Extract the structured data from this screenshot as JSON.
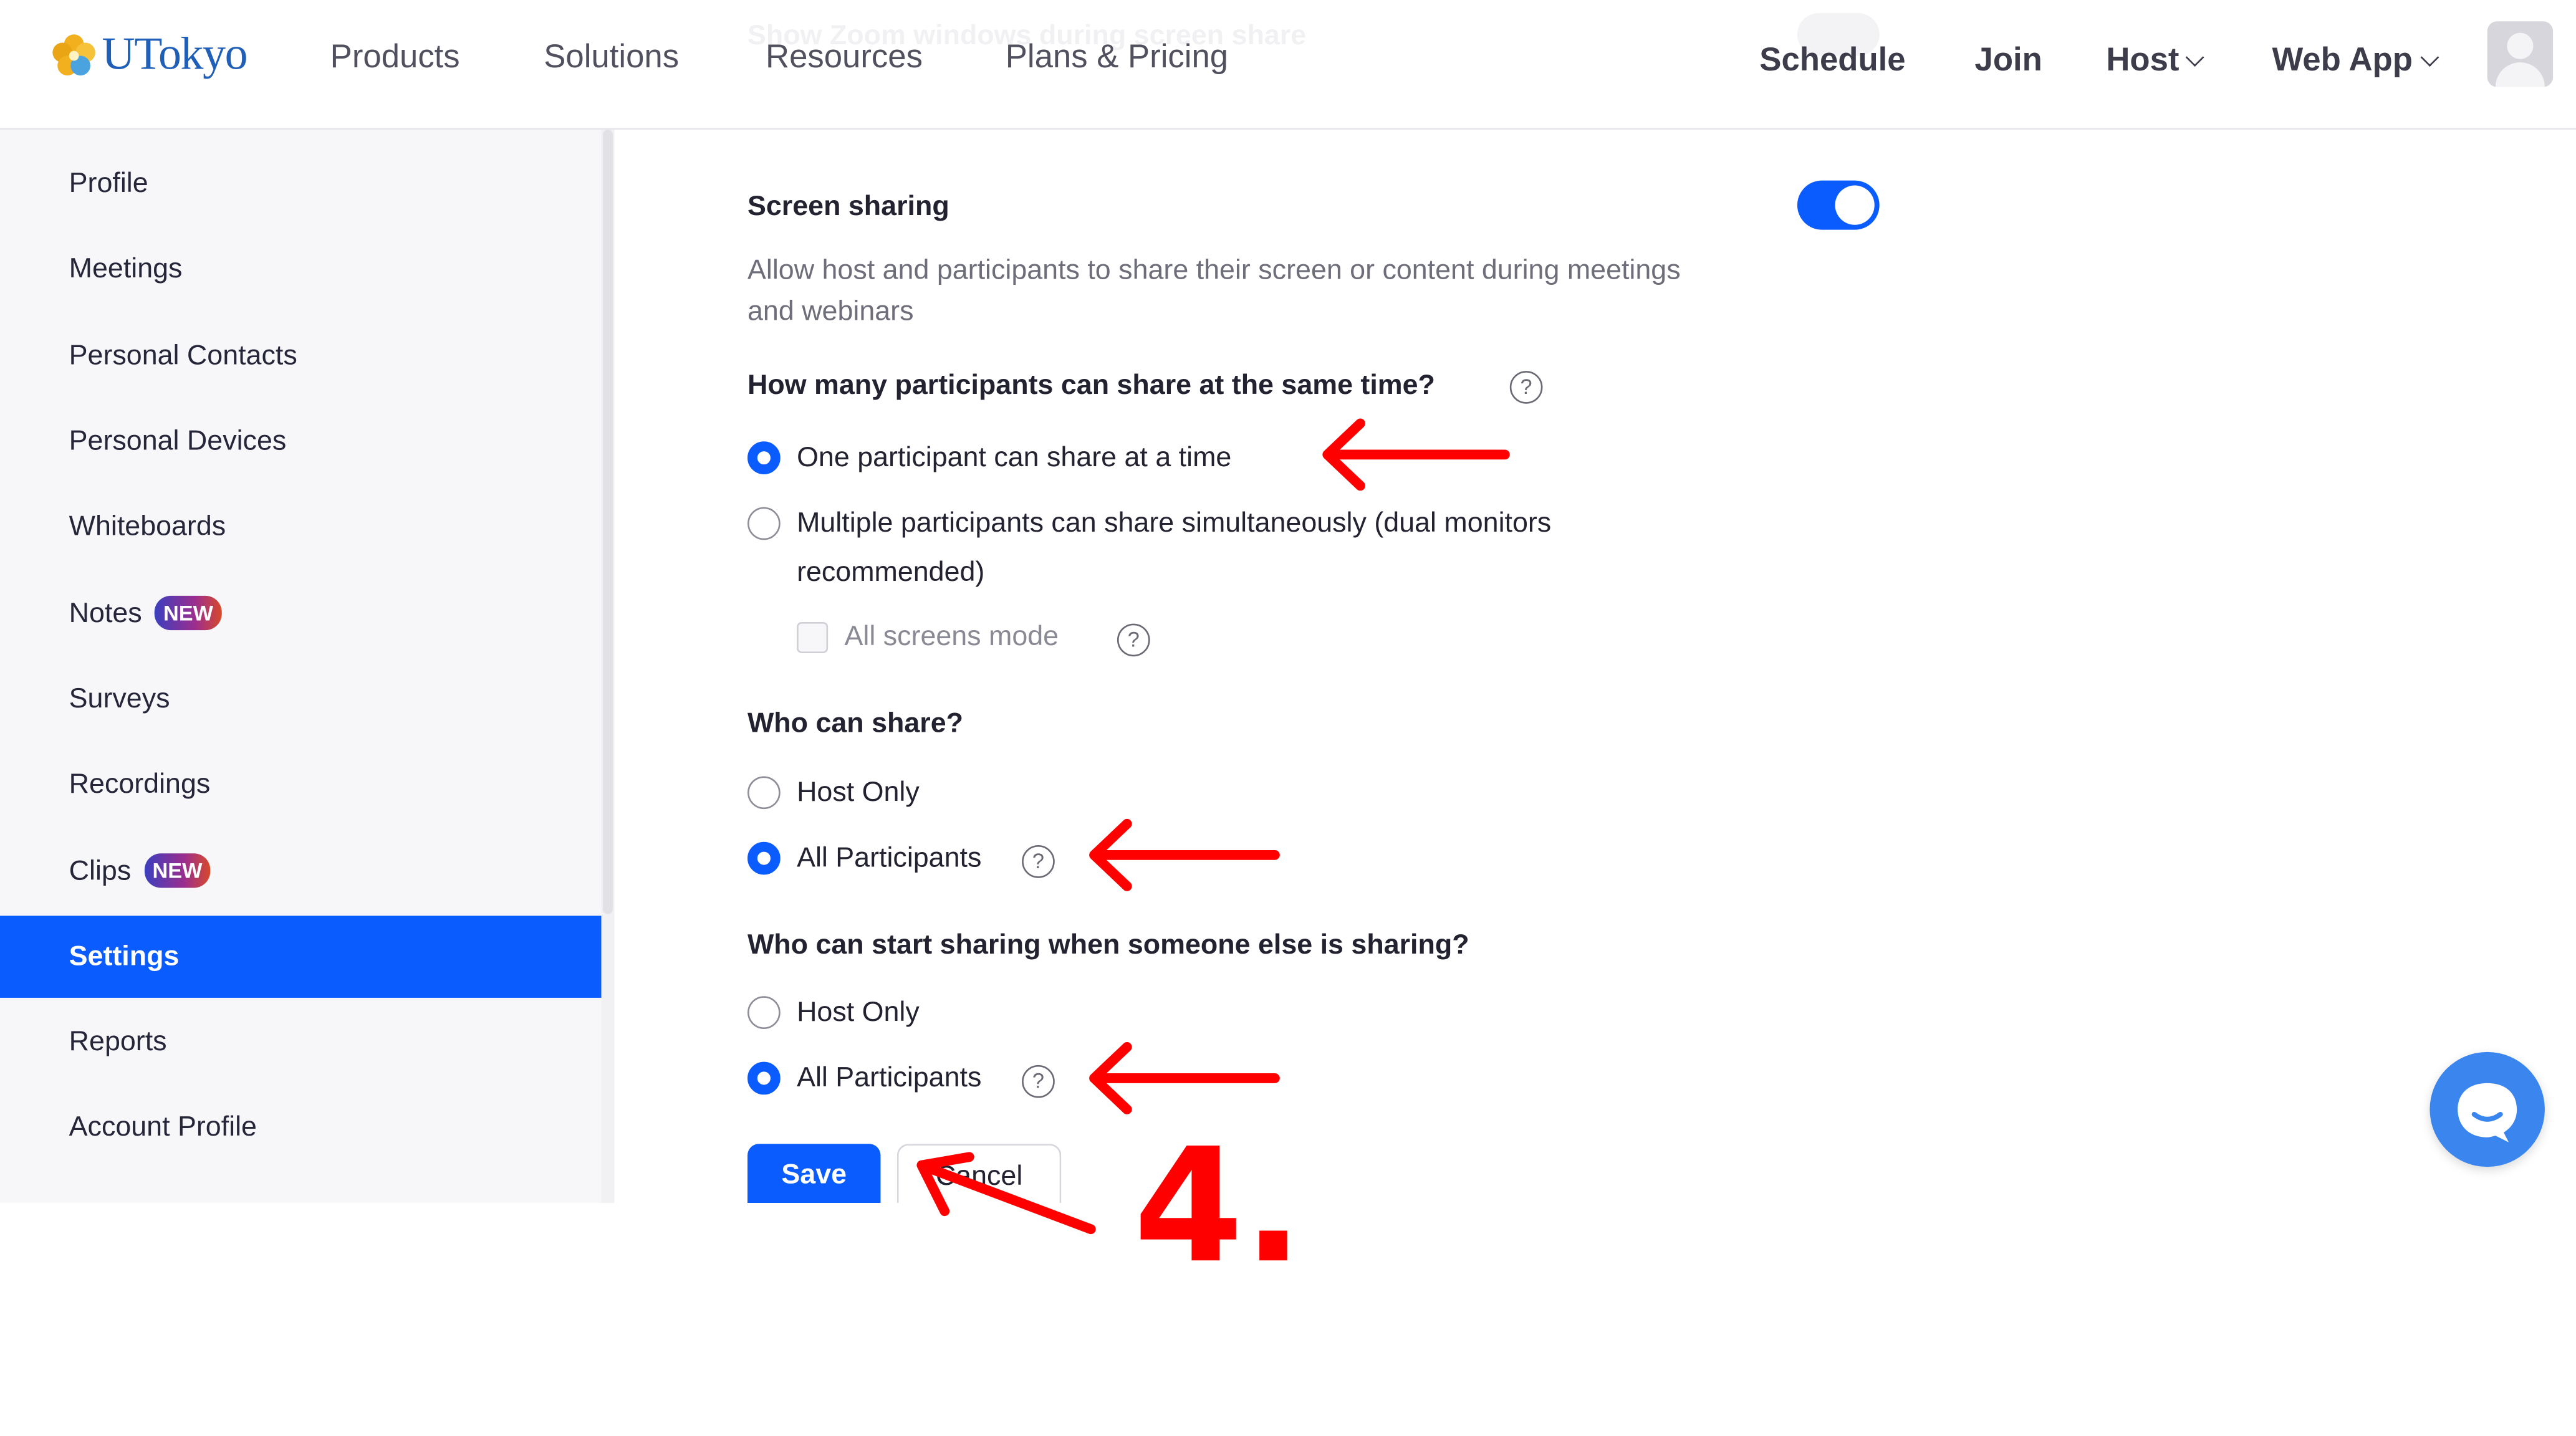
{
  "header": {
    "logo_text": "UTokyo",
    "nav": [
      "Products",
      "Solutions",
      "Resources",
      "Plans & Pricing"
    ],
    "right_nav": {
      "schedule": "Schedule",
      "join": "Join",
      "host": "Host",
      "web_app": "Web App"
    },
    "faded_setting": "Show Zoom windows during screen share"
  },
  "sidebar": {
    "items": [
      {
        "label": "Profile"
      },
      {
        "label": "Meetings"
      },
      {
        "label": "Personal Contacts"
      },
      {
        "label": "Personal Devices"
      },
      {
        "label": "Whiteboards"
      },
      {
        "label": "Notes",
        "badge": "NEW"
      },
      {
        "label": "Surveys"
      },
      {
        "label": "Recordings"
      },
      {
        "label": "Clips",
        "badge": "NEW"
      },
      {
        "label": "Settings",
        "active": true
      },
      {
        "label": "Reports"
      },
      {
        "label": "Account Profile"
      }
    ]
  },
  "main": {
    "screen_sharing": {
      "title": "Screen sharing",
      "enabled": true,
      "description": "Allow host and participants to share their screen or content during meetings and webinars"
    },
    "q_how_many": {
      "question": "How many participants can share at the same time?",
      "options": [
        {
          "label": "One participant can share at a time",
          "selected": true
        },
        {
          "label_line1": "Multiple participants can share simultaneously (dual monitors",
          "label_line2": "recommended)",
          "selected": false
        }
      ],
      "all_screens_mode": {
        "label": "All screens mode",
        "checked": false
      }
    },
    "q_who_can_share": {
      "question": "Who can share?",
      "options": [
        {
          "label": "Host Only",
          "selected": false
        },
        {
          "label": "All Participants",
          "selected": true
        }
      ]
    },
    "q_who_can_start": {
      "question": "Who can start sharing when someone else is sharing?",
      "options": [
        {
          "label": "Host Only",
          "selected": false
        },
        {
          "label": "All Participants",
          "selected": true
        }
      ]
    },
    "buttons": {
      "save": "Save",
      "cancel": "Cancel"
    }
  },
  "annotation": {
    "step_label": "4.",
    "color": "#ff0000"
  },
  "colors": {
    "accent": "#0b5cff",
    "badge_gradient": [
      "#3b3fbf",
      "#9b2e8f",
      "#d6492b"
    ],
    "chat": "#3a86ee"
  },
  "icons": [
    "flower-logo-icon",
    "chevron-down-icon",
    "help-circle-icon",
    "chat-bubble-icon",
    "user-avatar-icon"
  ]
}
